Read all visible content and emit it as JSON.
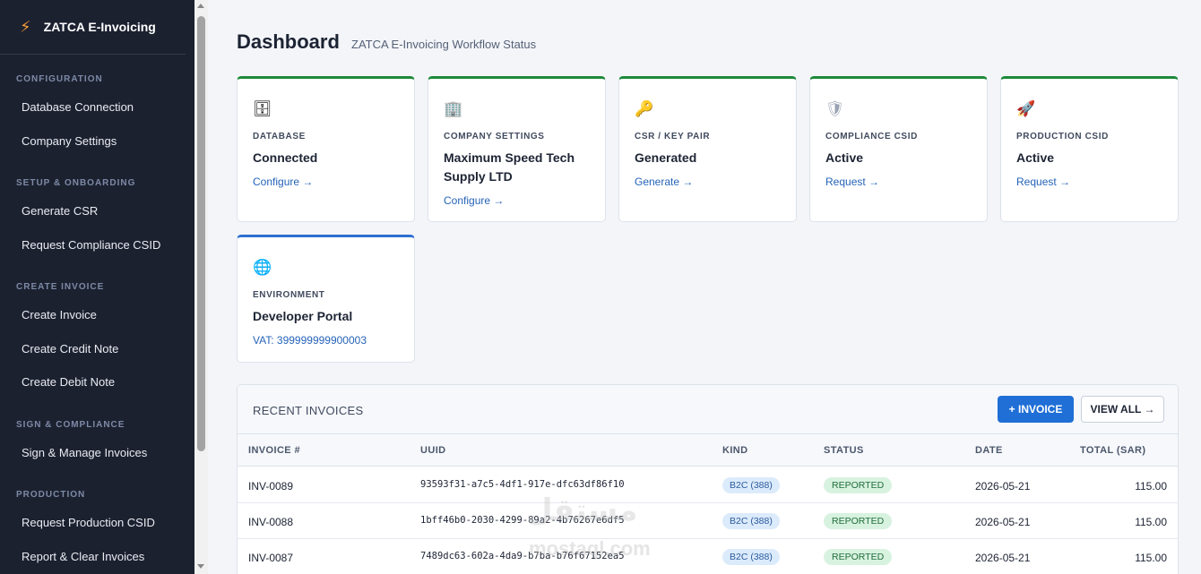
{
  "sidebar": {
    "brand": "ZATCA E-Invoicing",
    "sections": [
      {
        "title": "CONFIGURATION",
        "items": [
          "Database Connection",
          "Company Settings"
        ]
      },
      {
        "title": "SETUP & ONBOARDING",
        "items": [
          "Generate CSR",
          "Request Compliance CSID"
        ]
      },
      {
        "title": "CREATE INVOICE",
        "items": [
          "Create Invoice",
          "Create Credit Note",
          "Create Debit Note"
        ]
      },
      {
        "title": "SIGN & COMPLIANCE",
        "items": [
          "Sign & Manage Invoices"
        ]
      },
      {
        "title": "PRODUCTION",
        "items": [
          "Request Production CSID",
          "Report & Clear Invoices"
        ]
      }
    ]
  },
  "header": {
    "title": "Dashboard",
    "subtitle": "ZATCA E-Invoicing Workflow Status"
  },
  "cards": [
    {
      "icon": "database-icon",
      "glyph": "🗄",
      "label": "DATABASE",
      "value": "Connected",
      "link": "Configure →"
    },
    {
      "icon": "building-icon",
      "glyph": "🏢",
      "label": "COMPANY SETTINGS",
      "value": "Maximum Speed Tech Supply LTD",
      "link": "Configure →"
    },
    {
      "icon": "key-icon",
      "glyph": "🔑",
      "label": "CSR / KEY PAIR",
      "value": "Generated",
      "link": "Generate →"
    },
    {
      "icon": "shield-icon",
      "glyph": "🛡",
      "label": "COMPLIANCE CSID",
      "value": "Active",
      "link": "Request →"
    },
    {
      "icon": "rocket-icon",
      "glyph": "🚀",
      "label": "PRODUCTION CSID",
      "value": "Active",
      "link": "Request →"
    },
    {
      "icon": "globe-icon",
      "glyph": "🌐",
      "label": "ENVIRONMENT",
      "value": "Developer Portal",
      "link": "VAT: 399999999900003"
    }
  ],
  "invoices": {
    "title": "RECENT INVOICES",
    "new_button": "+ INVOICE",
    "view_all_button": "VIEW ALL →",
    "columns": [
      "INVOICE #",
      "UUID",
      "KIND",
      "STATUS",
      "DATE",
      "TOTAL (SAR)"
    ],
    "rows": [
      {
        "number": "INV-0089",
        "uuid": "93593f31-a7c5-4df1-917e-dfc63df86f10",
        "kind": "B2C (388)",
        "status": "REPORTED",
        "date": "2026-05-21",
        "total": "115.00"
      },
      {
        "number": "INV-0088",
        "uuid": "1bff46b0-2030-4299-89a2-4b76267e6df5",
        "kind": "B2C (388)",
        "status": "REPORTED",
        "date": "2026-05-21",
        "total": "115.00"
      },
      {
        "number": "INV-0087",
        "uuid": "7489dc63-602a-4da9-b7ba-b76f67152ea5",
        "kind": "B2C (388)",
        "status": "REPORTED",
        "date": "2026-05-21",
        "total": "115.00"
      }
    ]
  },
  "watermark": {
    "arabic": "مستقل",
    "latin": "mostaql.com"
  },
  "colors": {
    "sidebar_bg": "#1c2130",
    "accent_green": "#1e8a3a",
    "accent_blue": "#1f6fd6",
    "brand_bolt": "#f29a38"
  }
}
